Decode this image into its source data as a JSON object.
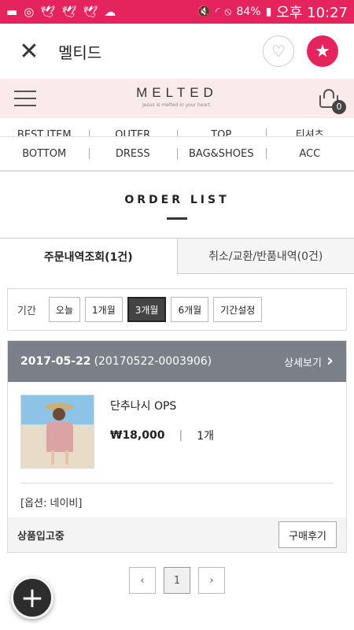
{
  "status_bar": {
    "icons": [
      "chat-icon",
      "record-icon",
      "twitter-icon",
      "twitter-icon",
      "twitter-icon",
      "cloud-icon"
    ],
    "battery": "84%",
    "time": "오후 10:27"
  },
  "app_bar": {
    "title": "멜티드"
  },
  "site": {
    "logo": "MELTED",
    "tagline": "Jesus is melted in your heart.",
    "cart_count": "0"
  },
  "categories": {
    "row1": [
      "BEST ITEM",
      "OUTER",
      "TOP",
      "티셔츠"
    ],
    "row2": [
      "BOTTOM",
      "DRESS",
      "BAG&SHOES",
      "ACC"
    ]
  },
  "page": {
    "title": "ORDER LIST"
  },
  "tabs": {
    "orders": "주문내역조회(1건)",
    "returns": "취소/교환/반품내역(0건)"
  },
  "period": {
    "label": "기간",
    "options": [
      "오늘",
      "1개월",
      "3개월",
      "6개월",
      "기간설정"
    ],
    "selected": "3개월"
  },
  "order": {
    "date": "2017-05-22",
    "number": "(20170522-0003906)",
    "detail_label": "상세보기",
    "product_name": "단추나시 OPS",
    "price": "₩18,000",
    "quantity": "1개",
    "option": "[옵션: 네이비]",
    "status": "상품입고중",
    "review_label": "구매후기"
  },
  "pagination": {
    "prev": "‹",
    "current": "1",
    "next": "›"
  },
  "colors": {
    "accent": "#e5245e",
    "header_bg": "#fbeaeb",
    "order_head_bg": "#7a7f88"
  }
}
